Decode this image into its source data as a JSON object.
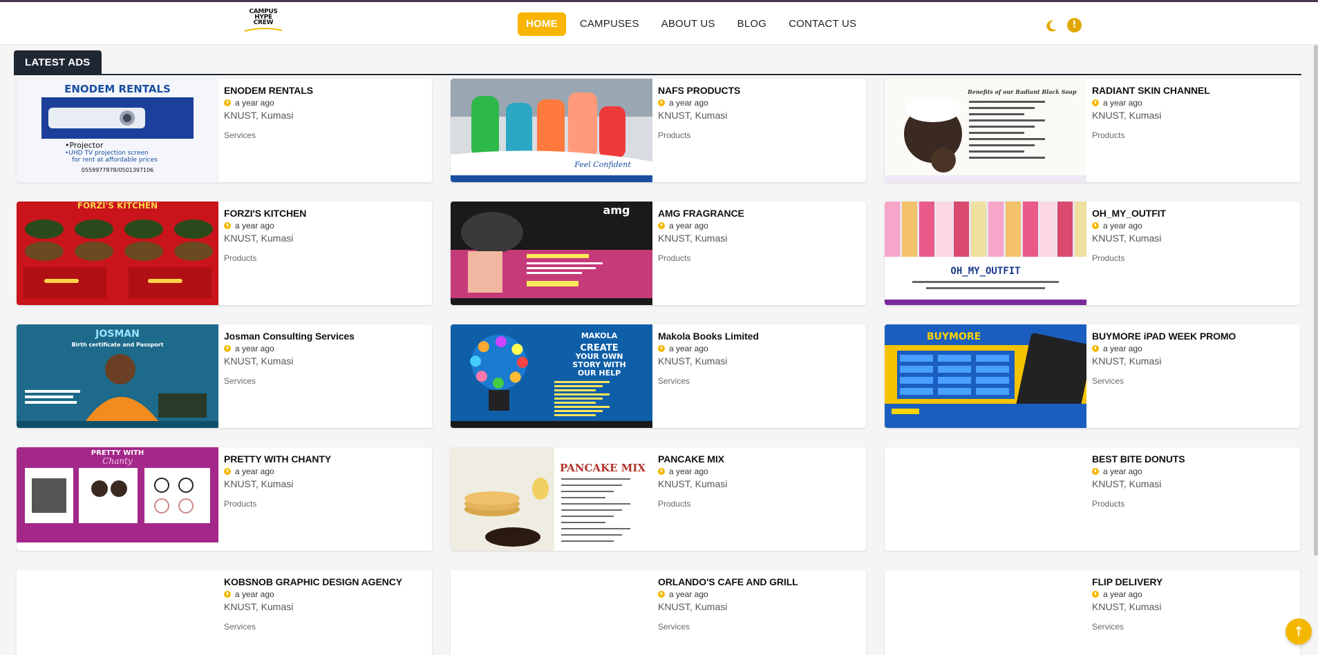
{
  "header": {
    "logo_text": "CAMPUS HYPE CREW",
    "nav": [
      {
        "label": "HOME",
        "active": true
      },
      {
        "label": "CAMPUSES",
        "active": false
      },
      {
        "label": "ABOUT US",
        "active": false
      },
      {
        "label": "BLOG",
        "active": false
      },
      {
        "label": "CONTACT US",
        "active": false
      }
    ],
    "theme_icon": "moon-icon",
    "info_icon": "info-icon",
    "info_symbol": "!"
  },
  "section": {
    "title": "LATEST ADS"
  },
  "ads": [
    {
      "title": "ENODEM RENTALS",
      "time": "a year ago",
      "location": "KNUST, Kumasi",
      "category": "Services",
      "thumb": "enodem"
    },
    {
      "title": "NAFS PRODUCTS",
      "time": "a year ago",
      "location": "KNUST, Kumasi",
      "category": "Products",
      "thumb": "nafs"
    },
    {
      "title": "RADIANT SKIN CHANNEL",
      "time": "a year ago",
      "location": "KNUST, Kumasi",
      "category": "Products",
      "thumb": "radiant"
    },
    {
      "title": "FORZI'S KITCHEN",
      "time": "a year ago",
      "location": "KNUST, Kumasi",
      "category": "Products",
      "thumb": "forzi"
    },
    {
      "title": "AMG FRAGRANCE",
      "time": "a year ago",
      "location": "KNUST, Kumasi",
      "category": "Products",
      "thumb": "amg"
    },
    {
      "title": "OH_MY_OUTFIT",
      "time": "a year ago",
      "location": "KNUST, Kumasi",
      "category": "Products",
      "thumb": "outfit"
    },
    {
      "title": "Josman Consulting Services",
      "time": "a year ago",
      "location": "KNUST, Kumasi",
      "category": "Services",
      "thumb": "josman"
    },
    {
      "title": "Makola Books Limited",
      "time": "a year ago",
      "location": "KNUST, Kumasi",
      "category": "Services",
      "thumb": "makola"
    },
    {
      "title": "BUYMORE iPAD WEEK PROMO",
      "time": "a year ago",
      "location": "KNUST, Kumasi",
      "category": "Services",
      "thumb": "buymore"
    },
    {
      "title": "PRETTY WITH CHANTY",
      "time": "a year ago",
      "location": "KNUST, Kumasi",
      "category": "Products",
      "thumb": "chanty"
    },
    {
      "title": "PANCAKE MIX",
      "time": "a year ago",
      "location": "KNUST, Kumasi",
      "category": "Products",
      "thumb": "pancake"
    },
    {
      "title": "BEST BITE DONUTS",
      "time": "a year ago",
      "location": "KNUST, Kumasi",
      "category": "Products",
      "thumb": "blank"
    },
    {
      "title": "KOBSNOB GRAPHIC DESIGN AGENCY",
      "time": "a year ago",
      "location": "KNUST, Kumasi",
      "category": "Services",
      "thumb": "blank"
    },
    {
      "title": "ORLANDO'S CAFE AND GRILL",
      "time": "a year ago",
      "location": "KNUST, Kumasi",
      "category": "Services",
      "thumb": "blank"
    },
    {
      "title": "FLIP DELIVERY",
      "time": "a year ago",
      "location": "KNUST, Kumasi",
      "category": "Services",
      "thumb": "blank"
    }
  ],
  "thumb_text": {
    "enodem": {
      "heading": "ENODEM RENTALS",
      "line1": "•Projector",
      "line2": "•UHD TV projection screen",
      "line3": "for rent at affordable prices",
      "line4": "0559977878/0501397106"
    },
    "nafs": {
      "tag": "Feel Confident"
    },
    "radiant": {
      "heading": "Benefits of our Radiant Black Soap"
    },
    "forzi": {
      "heading": "FORZI'S KITCHEN"
    },
    "amg": {
      "heading": "amg"
    },
    "outfit": {
      "heading": "OH_MY_OUTFIT"
    },
    "josman": {
      "heading": "JOSMAN",
      "sub": "Birth certificate and Passport"
    },
    "makola": {
      "heading": "MAKOLA",
      "line1": "CREATE",
      "line2": "YOUR OWN",
      "line3": "STORY WITH",
      "line4": "OUR HELP"
    },
    "buymore": {
      "heading": "BUYMORE"
    },
    "chanty": {
      "heading": "PRETTY WITH",
      "sub": "Chanty"
    },
    "pancake": {
      "heading": "PANCAKE MIX"
    }
  },
  "colors": {
    "accent": "#f7b500",
    "section_bg": "#1f2733"
  }
}
